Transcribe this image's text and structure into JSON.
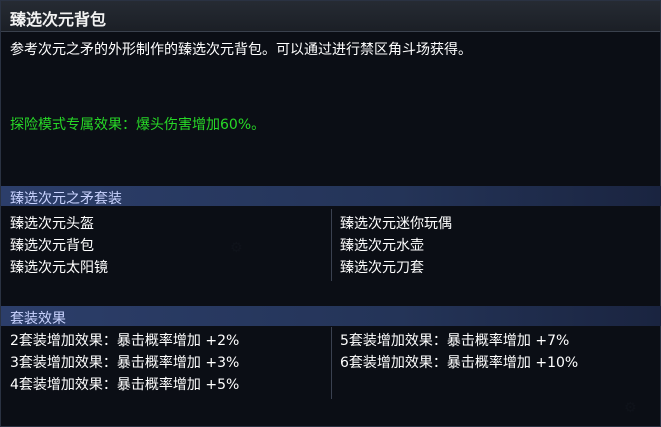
{
  "tooltip": {
    "title": "臻选次元背包",
    "description": "参考次元之矛的外形制作的臻选次元背包。可以通过进行禁区角斗场获得。",
    "special_effect": "探险模式专属效果：爆头伤害增加60%。"
  },
  "set_section": {
    "title": "臻选次元之矛套装",
    "items_left": [
      "臻选次元头盔",
      "臻选次元背包",
      "臻选次元太阳镜"
    ],
    "items_right": [
      "臻选次元迷你玩偶",
      "臻选次元水壶",
      "臻选次元刀套"
    ]
  },
  "set_effects": {
    "title": "套装效果",
    "left": [
      "2套装增加效果：暴击概率增加 +2%",
      "3套装增加效果：暴击概率增加 +3%",
      "4套装增加效果：暴击概率增加 +5%"
    ],
    "right": [
      "5套装增加效果：暴击概率增加 +7%",
      "6套装增加效果：暴击概率增加 +10%"
    ]
  },
  "colors": {
    "effect_green": "#27d827",
    "section_bar": "#2c3e6a"
  }
}
